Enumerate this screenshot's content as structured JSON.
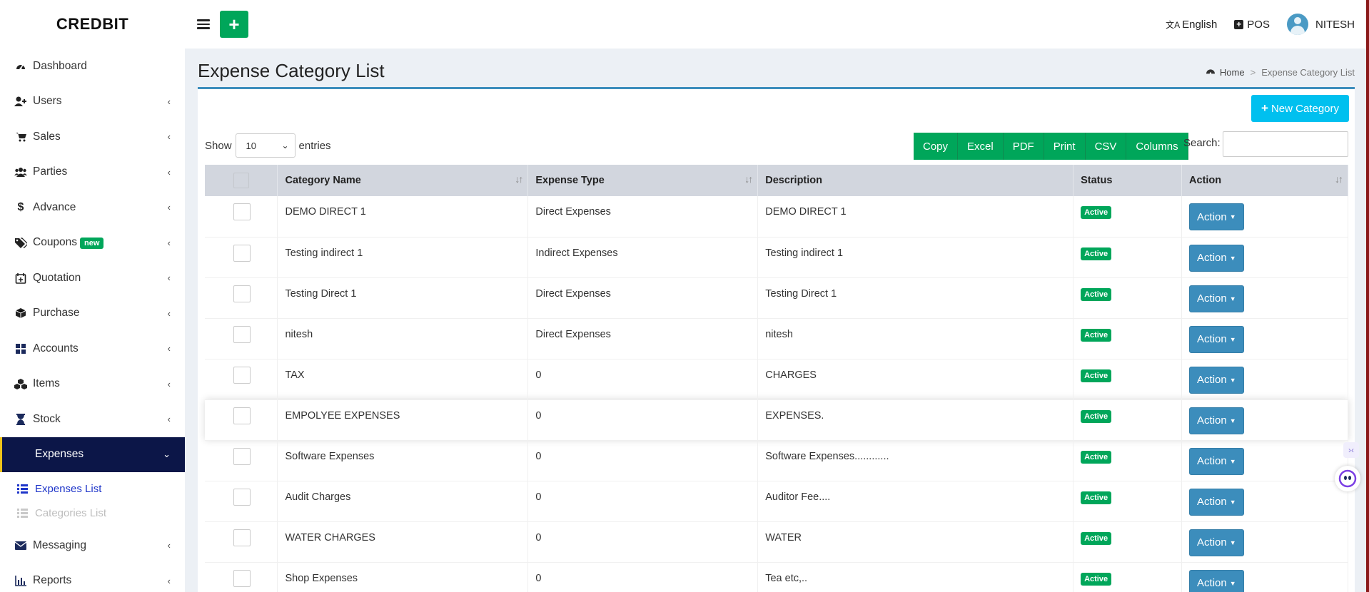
{
  "brand": "CREDBIT",
  "sidebar": {
    "items": [
      {
        "label": "Dashboard",
        "icon": "dashboard-icon",
        "chevron": ""
      },
      {
        "label": "Users",
        "icon": "user-plus-icon",
        "chevron": "‹"
      },
      {
        "label": "Sales",
        "icon": "cart-icon",
        "chevron": "‹"
      },
      {
        "label": "Parties",
        "icon": "users-icon",
        "chevron": "‹"
      },
      {
        "label": "Advance",
        "icon": "dollar-icon",
        "chevron": "‹"
      },
      {
        "label": "Coupons",
        "icon": "tags-icon",
        "badge": "new",
        "chevron": "‹"
      },
      {
        "label": "Quotation",
        "icon": "calendar-plus-icon",
        "chevron": "‹"
      },
      {
        "label": "Purchase",
        "icon": "cube-icon",
        "chevron": "‹"
      },
      {
        "label": "Accounts",
        "icon": "grid-icon",
        "chevron": "‹"
      },
      {
        "label": "Items",
        "icon": "cubes-icon",
        "chevron": "‹"
      },
      {
        "label": "Stock",
        "icon": "hourglass-icon",
        "chevron": "‹"
      },
      {
        "label": "Expenses",
        "icon": "",
        "chevron": "⌄"
      },
      {
        "label": "Messaging",
        "icon": "envelope-icon",
        "chevron": "‹"
      },
      {
        "label": "Reports",
        "icon": "bar-chart-icon",
        "chevron": "‹"
      }
    ],
    "expenses_sub": [
      {
        "label": "Expenses List"
      },
      {
        "label": "Categories List"
      }
    ]
  },
  "topbar": {
    "language": "English",
    "pos": "POS",
    "user": "NITESH"
  },
  "page": {
    "title": "Expense Category List",
    "breadcrumb_home": "Home",
    "breadcrumb_sep": ">",
    "breadcrumb_current": "Expense Category List",
    "new_category": "New Category"
  },
  "table_controls": {
    "show": "Show",
    "entries_value": "10",
    "entries": "entries",
    "buttons": [
      "Copy",
      "Excel",
      "PDF",
      "Print",
      "CSV",
      "Columns"
    ],
    "search_label": "Search:"
  },
  "table": {
    "headers": [
      "Category Name",
      "Expense Type",
      "Description",
      "Status",
      "Action"
    ],
    "rows": [
      {
        "name": "DEMO DIRECT 1",
        "type": "Direct Expenses",
        "desc": "DEMO DIRECT 1",
        "status": "Active",
        "action": "Action"
      },
      {
        "name": "Testing indirect 1",
        "type": "Indirect Expenses",
        "desc": "Testing indirect 1",
        "status": "Active",
        "action": "Action"
      },
      {
        "name": "Testing Direct 1",
        "type": "Direct Expenses",
        "desc": "Testing Direct 1",
        "status": "Active",
        "action": "Action"
      },
      {
        "name": "nitesh",
        "type": "Direct Expenses",
        "desc": "nitesh",
        "status": "Active",
        "action": "Action"
      },
      {
        "name": "TAX",
        "type": "0",
        "desc": "CHARGES",
        "status": "Active",
        "action": "Action"
      },
      {
        "name": "EMPOLYEE EXPENSES",
        "type": "0",
        "desc": "EXPENSES.",
        "status": "Active",
        "action": "Action"
      },
      {
        "name": "Software Expenses",
        "type": "0",
        "desc": "Software Expenses............",
        "status": "Active",
        "action": "Action"
      },
      {
        "name": "Audit Charges",
        "type": "0",
        "desc": "Auditor Fee....",
        "status": "Active",
        "action": "Action"
      },
      {
        "name": "WATER CHARGES",
        "type": "0",
        "desc": "WATER",
        "status": "Active",
        "action": "Action"
      },
      {
        "name": "Shop Expenses",
        "type": "0",
        "desc": "Tea etc,..",
        "status": "Active",
        "action": "Action"
      }
    ]
  },
  "colors": {
    "green": "#00a65a",
    "blue": "#3c8dbc",
    "cyan": "#00c0ef",
    "navy": "#0c1648"
  }
}
